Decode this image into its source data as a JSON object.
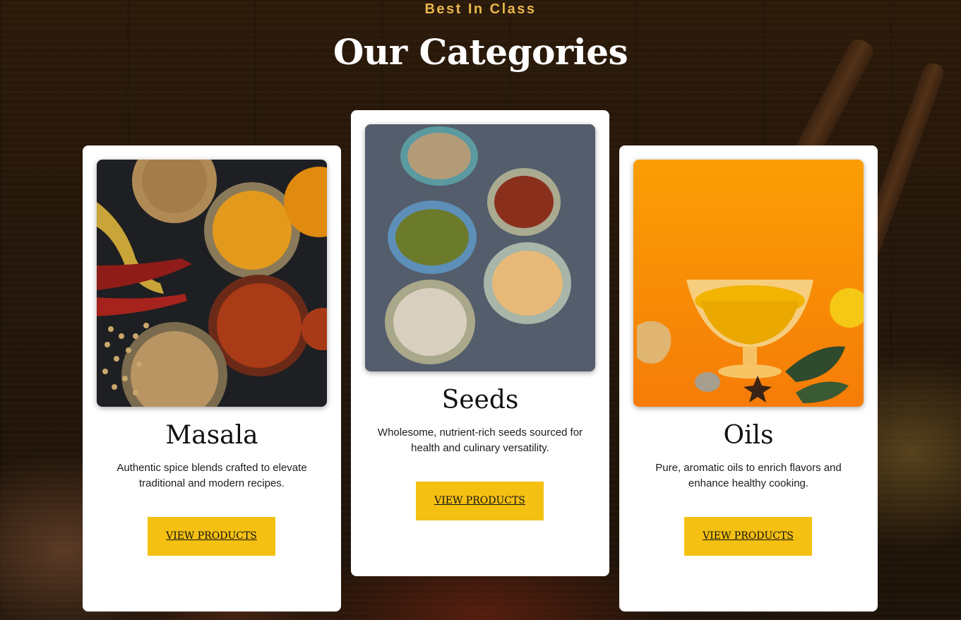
{
  "section": {
    "eyebrow": "Best In Class",
    "title": "Our Categories"
  },
  "categories": [
    {
      "name": "Masala",
      "description": "Authentic spice blends crafted to elevate traditional and modern recipes.",
      "button_label": "VIEW PRODUCTS",
      "image": "masala-spices-photo"
    },
    {
      "name": "Seeds",
      "description": "Wholesome, nutrient-rich seeds sourced for health and culinary versatility.",
      "button_label": "VIEW PRODUCTS",
      "image": "seeds-bowls-photo"
    },
    {
      "name": "Oils",
      "description": "Pure, aromatic oils to enrich flavors and enhance healthy cooking.",
      "button_label": "VIEW PRODUCTS",
      "image": "oil-bowl-photo"
    }
  ],
  "colors": {
    "accent": "#f4c012",
    "eyebrow": "#e8b64c",
    "background": "#2b1a09",
    "card": "#ffffff"
  }
}
